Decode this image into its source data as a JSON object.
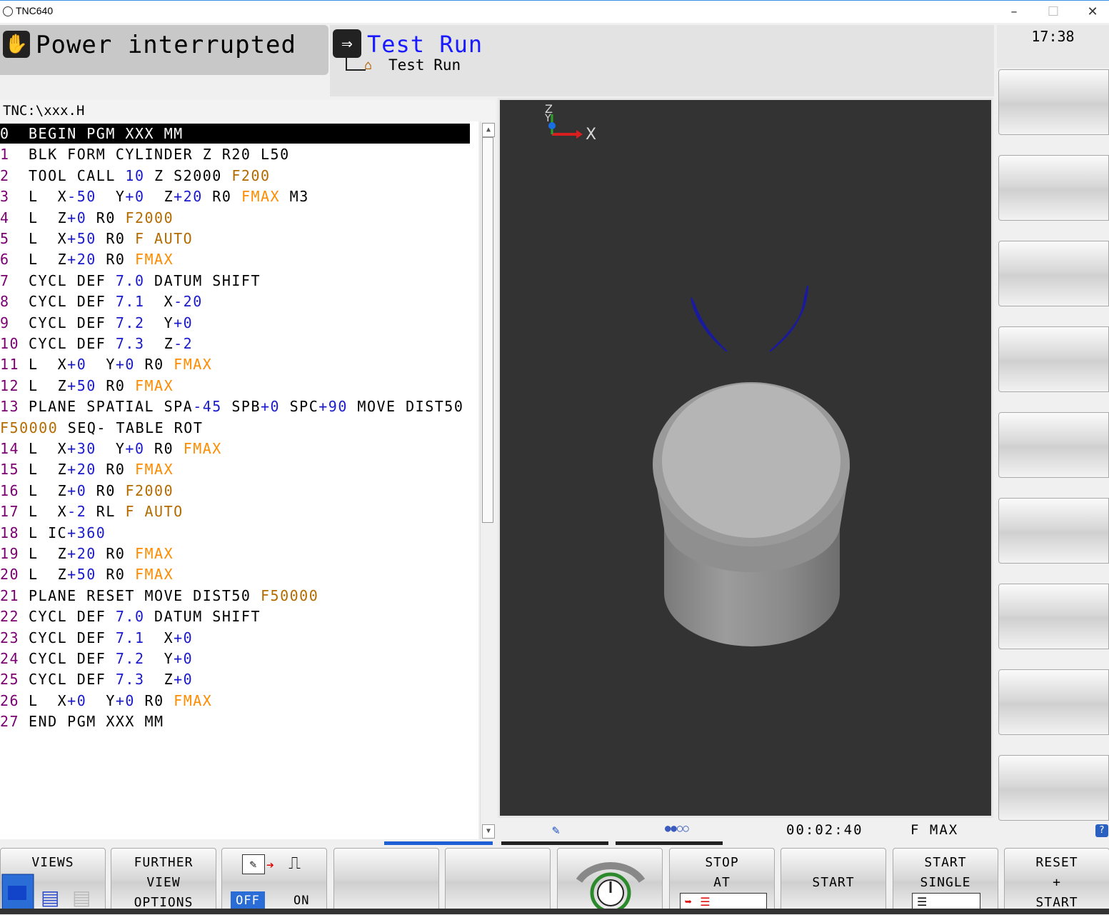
{
  "window": {
    "title": "TNC640",
    "controls": [
      "–",
      "☐",
      "✕"
    ]
  },
  "mode": {
    "machine": "Power interrupted",
    "programming": "Test Run",
    "sub": "Test Run",
    "clock": "17:38"
  },
  "program": {
    "path": "TNC:\\xxx.H",
    "lines": [
      {
        "n": "0",
        "parts": [
          [
            "k",
            "BEGIN PGM XXX MM"
          ]
        ]
      },
      {
        "n": "1",
        "parts": [
          [
            "k",
            "BLK FORM CYLINDER Z R20 L50"
          ]
        ]
      },
      {
        "n": "2",
        "parts": [
          [
            "k",
            "TOOL CALL "
          ],
          [
            "n",
            "10"
          ],
          [
            "k",
            " Z S2000 "
          ],
          [
            "b",
            "F200"
          ]
        ]
      },
      {
        "n": "3",
        "parts": [
          [
            "k",
            "L  X"
          ],
          [
            "n",
            "-50"
          ],
          [
            "k",
            "  Y"
          ],
          [
            "n",
            "+0"
          ],
          [
            "k",
            "  Z"
          ],
          [
            "n",
            "+20"
          ],
          [
            "k",
            " R0 "
          ],
          [
            "o",
            "FMAX"
          ],
          [
            "k",
            " M3"
          ]
        ]
      },
      {
        "n": "4",
        "parts": [
          [
            "k",
            "L  Z"
          ],
          [
            "n",
            "+0"
          ],
          [
            "k",
            " R0 "
          ],
          [
            "b",
            "F2000"
          ]
        ]
      },
      {
        "n": "5",
        "parts": [
          [
            "k",
            "L  X"
          ],
          [
            "n",
            "+50"
          ],
          [
            "k",
            " R0 "
          ],
          [
            "b",
            "F AUTO"
          ]
        ]
      },
      {
        "n": "6",
        "parts": [
          [
            "k",
            "L  Z"
          ],
          [
            "n",
            "+20"
          ],
          [
            "k",
            " R0 "
          ],
          [
            "o",
            "FMAX"
          ]
        ]
      },
      {
        "n": "7",
        "parts": [
          [
            "k",
            "CYCL DEF "
          ],
          [
            "n",
            "7.0"
          ],
          [
            "k",
            " DATUM SHIFT"
          ]
        ]
      },
      {
        "n": "8",
        "parts": [
          [
            "k",
            "CYCL DEF "
          ],
          [
            "n",
            "7.1"
          ],
          [
            "k",
            "  X"
          ],
          [
            "n",
            "-20"
          ]
        ]
      },
      {
        "n": "9",
        "parts": [
          [
            "k",
            "CYCL DEF "
          ],
          [
            "n",
            "7.2"
          ],
          [
            "k",
            "  Y"
          ],
          [
            "n",
            "+0"
          ]
        ]
      },
      {
        "n": "10",
        "parts": [
          [
            "k",
            "CYCL DEF "
          ],
          [
            "n",
            "7.3"
          ],
          [
            "k",
            "  Z"
          ],
          [
            "n",
            "-2"
          ]
        ]
      },
      {
        "n": "11",
        "parts": [
          [
            "k",
            "L  X"
          ],
          [
            "n",
            "+0"
          ],
          [
            "k",
            "  Y"
          ],
          [
            "n",
            "+0"
          ],
          [
            "k",
            " R0 "
          ],
          [
            "o",
            "FMAX"
          ]
        ]
      },
      {
        "n": "12",
        "parts": [
          [
            "k",
            "L  Z"
          ],
          [
            "n",
            "+50"
          ],
          [
            "k",
            " R0 "
          ],
          [
            "o",
            "FMAX"
          ]
        ]
      },
      {
        "n": "13",
        "parts": [
          [
            "k",
            "PLANE SPATIAL SPA"
          ],
          [
            "n",
            "-45"
          ],
          [
            "k",
            " SPB"
          ],
          [
            "n",
            "+0"
          ],
          [
            "k",
            " SPC"
          ],
          [
            "n",
            "+90"
          ],
          [
            "k",
            " MOVE DIST50"
          ]
        ]
      },
      {
        "n": "",
        "parts": [
          [
            "b",
            "F50000"
          ],
          [
            "k",
            " SEQ- TABLE ROT"
          ]
        ]
      },
      {
        "n": "14",
        "parts": [
          [
            "k",
            "L  X"
          ],
          [
            "n",
            "+30"
          ],
          [
            "k",
            "  Y"
          ],
          [
            "n",
            "+0"
          ],
          [
            "k",
            " R0 "
          ],
          [
            "o",
            "FMAX"
          ]
        ]
      },
      {
        "n": "15",
        "parts": [
          [
            "k",
            "L  Z"
          ],
          [
            "n",
            "+20"
          ],
          [
            "k",
            " R0 "
          ],
          [
            "o",
            "FMAX"
          ]
        ]
      },
      {
        "n": "16",
        "parts": [
          [
            "k",
            "L  Z"
          ],
          [
            "n",
            "+0"
          ],
          [
            "k",
            " R0 "
          ],
          [
            "b",
            "F2000"
          ]
        ]
      },
      {
        "n": "17",
        "parts": [
          [
            "k",
            "L  X"
          ],
          [
            "n",
            "-2"
          ],
          [
            "k",
            " RL "
          ],
          [
            "b",
            "F AUTO"
          ]
        ]
      },
      {
        "n": "18",
        "parts": [
          [
            "k",
            "L IC"
          ],
          [
            "n",
            "+360"
          ]
        ]
      },
      {
        "n": "19",
        "parts": [
          [
            "k",
            "L  Z"
          ],
          [
            "n",
            "+20"
          ],
          [
            "k",
            " R0 "
          ],
          [
            "o",
            "FMAX"
          ]
        ]
      },
      {
        "n": "20",
        "parts": [
          [
            "k",
            "L  Z"
          ],
          [
            "n",
            "+50"
          ],
          [
            "k",
            " R0 "
          ],
          [
            "o",
            "FMAX"
          ]
        ]
      },
      {
        "n": "21",
        "parts": [
          [
            "k",
            "PLANE RESET MOVE DIST50 "
          ],
          [
            "b",
            "F50000"
          ]
        ]
      },
      {
        "n": "22",
        "parts": [
          [
            "k",
            "CYCL DEF "
          ],
          [
            "n",
            "7.0"
          ],
          [
            "k",
            " DATUM SHIFT"
          ]
        ]
      },
      {
        "n": "23",
        "parts": [
          [
            "k",
            "CYCL DEF "
          ],
          [
            "n",
            "7.1"
          ],
          [
            "k",
            "  X"
          ],
          [
            "n",
            "+0"
          ]
        ]
      },
      {
        "n": "24",
        "parts": [
          [
            "k",
            "CYCL DEF "
          ],
          [
            "n",
            "7.2"
          ],
          [
            "k",
            "  Y"
          ],
          [
            "n",
            "+0"
          ]
        ]
      },
      {
        "n": "25",
        "parts": [
          [
            "k",
            "CYCL DEF "
          ],
          [
            "n",
            "7.3"
          ],
          [
            "k",
            "  Z"
          ],
          [
            "n",
            "+0"
          ]
        ]
      },
      {
        "n": "26",
        "parts": [
          [
            "k",
            "L  X"
          ],
          [
            "n",
            "+0"
          ],
          [
            "k",
            "  Y"
          ],
          [
            "n",
            "+0"
          ],
          [
            "k",
            " R0 "
          ],
          [
            "o",
            "FMAX"
          ]
        ]
      },
      {
        "n": "27",
        "parts": [
          [
            "k",
            "END PGM XXX MM"
          ]
        ]
      }
    ]
  },
  "graphics": {
    "axis_x": "X",
    "axis_z": "Z",
    "axis_y": "Y"
  },
  "status": {
    "time": "00:02:40",
    "feed": "F MAX",
    "dots": "●●○○",
    "help": "?"
  },
  "softkeys": {
    "views": "VIEWS",
    "further": "FURTHER\nVIEW\nOPTIONS",
    "toggle_off": "OFF",
    "toggle_on": "ON",
    "stop_at": "STOP\nAT",
    "start": "START",
    "start_single": "START\nSINGLE",
    "reset_start": "RESET\n+\nSTART"
  },
  "colors": {
    "number": "#1a1acc",
    "fmax": "#ff8c00",
    "feed": "#b36b00",
    "linenum": "#7a0070",
    "accent": "#3a6fd8"
  }
}
